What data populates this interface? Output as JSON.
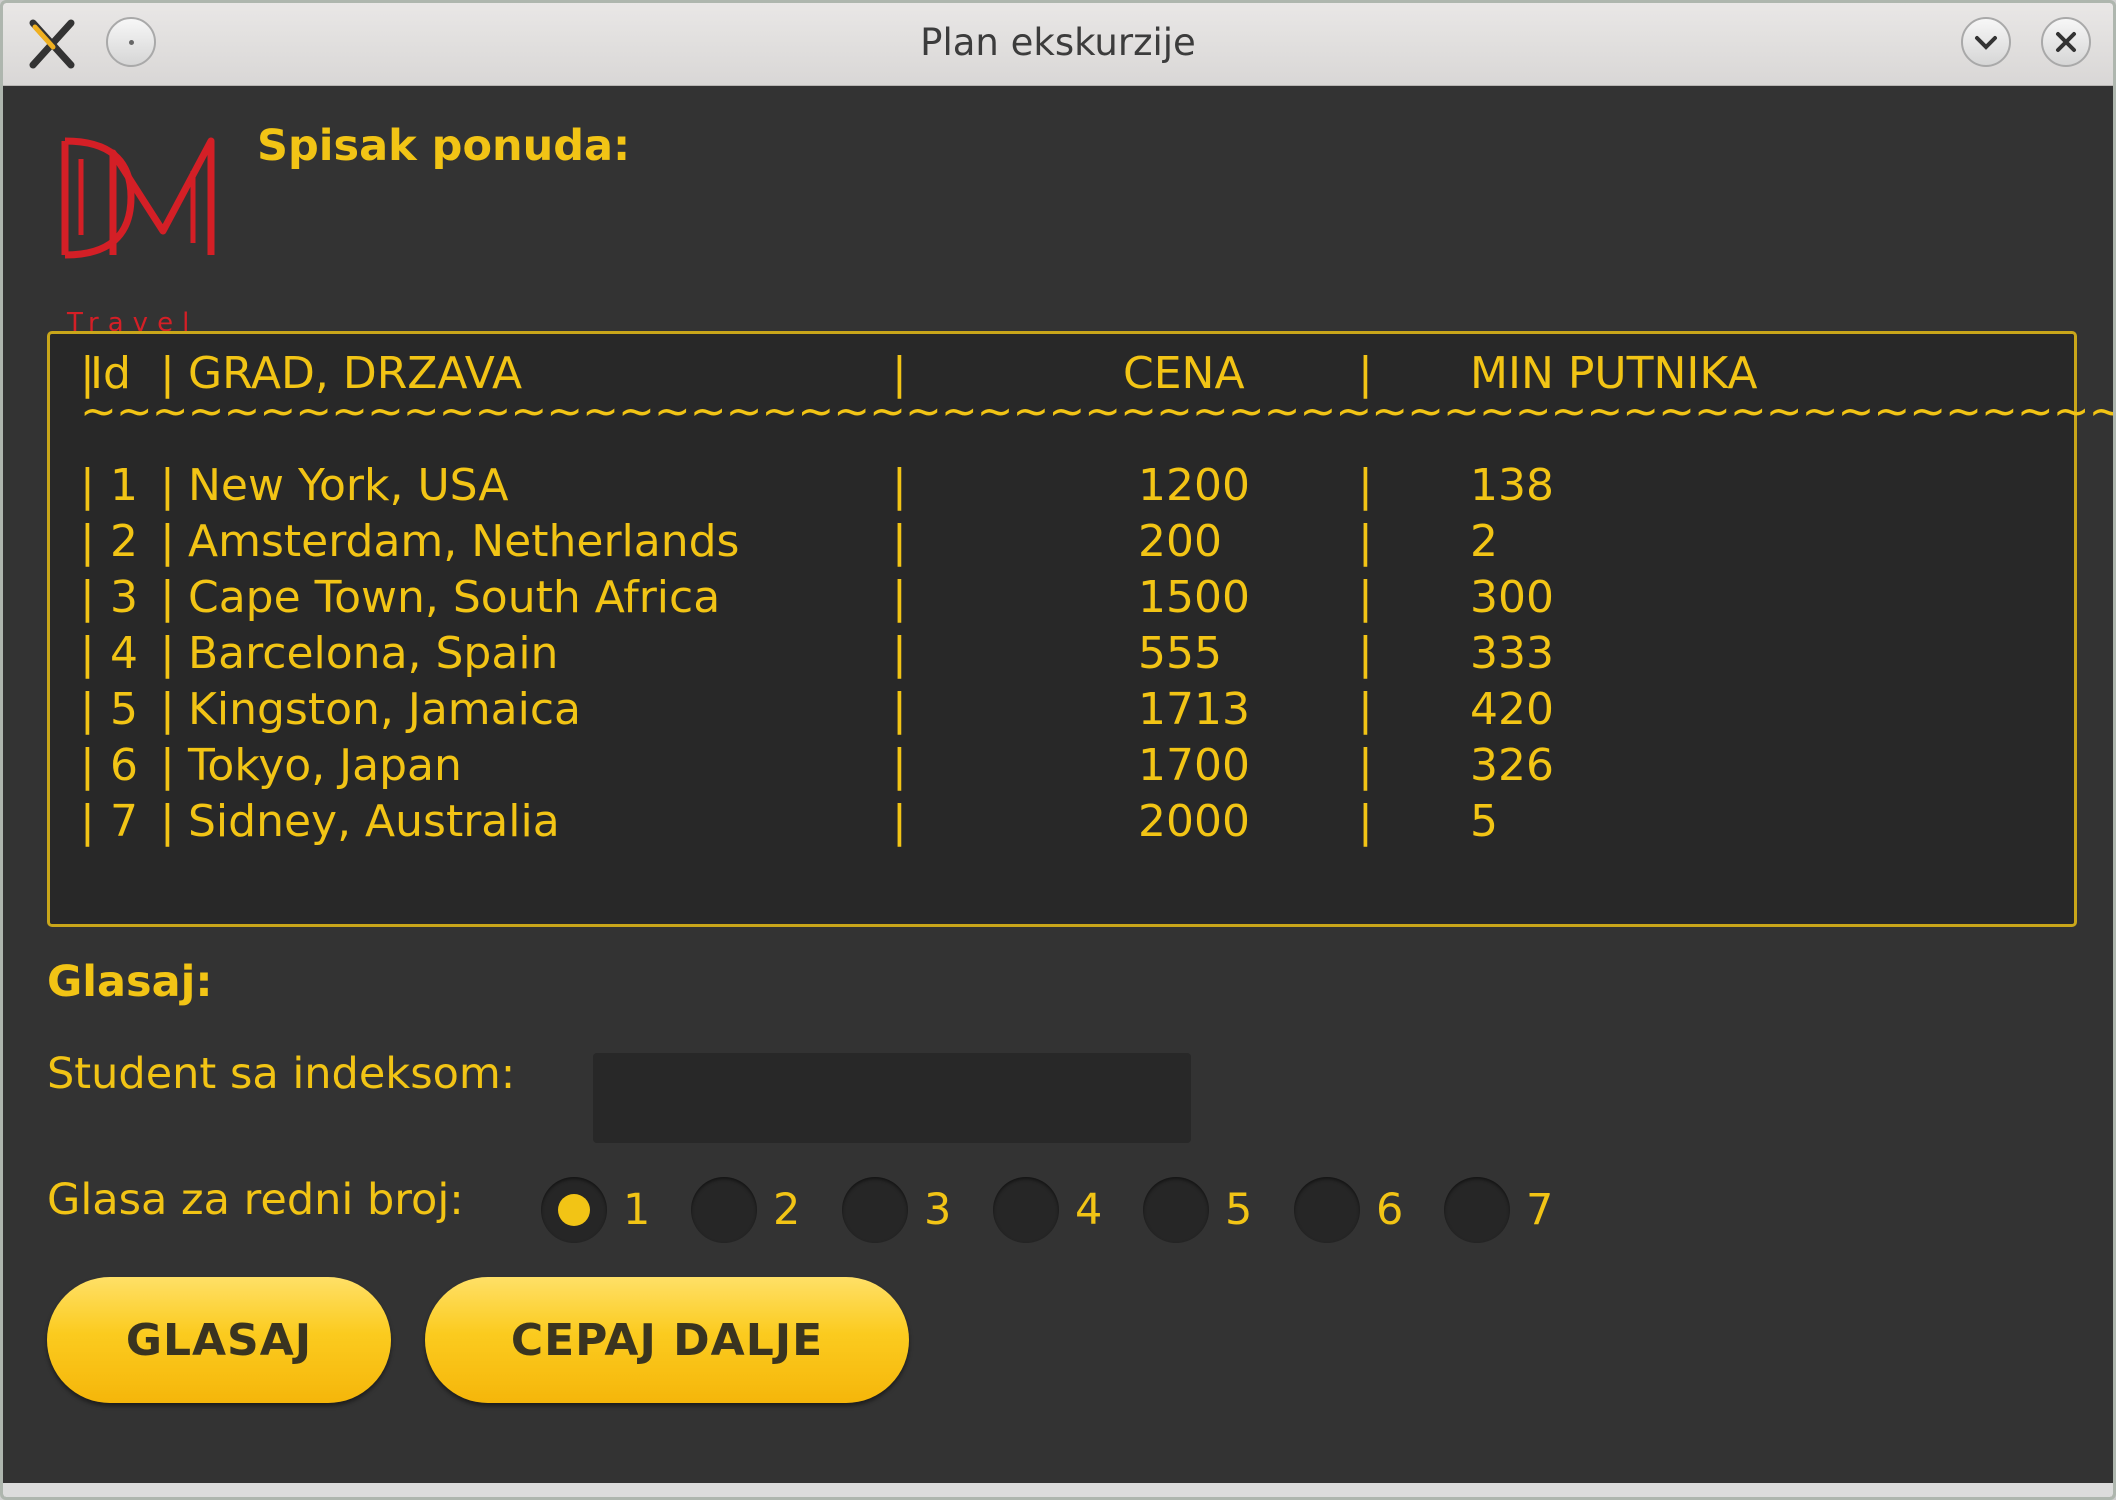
{
  "window": {
    "title": "Plan ekskurzije"
  },
  "logo": {
    "text": "Travel",
    "monogram": "DM"
  },
  "offers": {
    "heading": "Spisak ponuda:",
    "header": {
      "bar1": "|",
      "id": "Id",
      "bar2": "|",
      "city": "GRAD, DRZAVA",
      "bar3": "|",
      "price": "CENA",
      "bar4": "|",
      "min": "MIN PUTNIKA"
    },
    "separator": "~~~~~~~~~~~~~~~~~~~~~~~~~~~~~~~~~~~~~~~~~~~~~~~~~~~~~~~~~~~~~~~~~~~~~",
    "rows": [
      {
        "id": "1",
        "city": "New York, USA",
        "price": "1200",
        "min": "138"
      },
      {
        "id": "2",
        "city": "Amsterdam, Netherlands",
        "price": "200",
        "min": "2"
      },
      {
        "id": "3",
        "city": "Cape Town, South Africa",
        "price": "1500",
        "min": "300"
      },
      {
        "id": "4",
        "city": "Barcelona, Spain",
        "price": "555",
        "min": "333"
      },
      {
        "id": "5",
        "city": "Kingston, Jamaica",
        "price": "1713",
        "min": "420"
      },
      {
        "id": "6",
        "city": "Tokyo, Japan",
        "price": "1700",
        "min": "326"
      },
      {
        "id": "7",
        "city": "Sidney, Australia",
        "price": "2000",
        "min": "5"
      }
    ]
  },
  "vote": {
    "heading": "Glasaj:",
    "student_label": "Student sa indeksom:",
    "student_value": "",
    "choice_label": "Glasa za redni broj:",
    "options": [
      "1",
      "2",
      "3",
      "4",
      "5",
      "6",
      "7"
    ],
    "selected": "1"
  },
  "buttons": {
    "vote": "GLASAJ",
    "exit": "CEPAJ DALJE"
  },
  "colors": {
    "accent": "#f2c415",
    "background": "#333333",
    "list_bg": "#282828",
    "logo_red": "#d41f26"
  }
}
